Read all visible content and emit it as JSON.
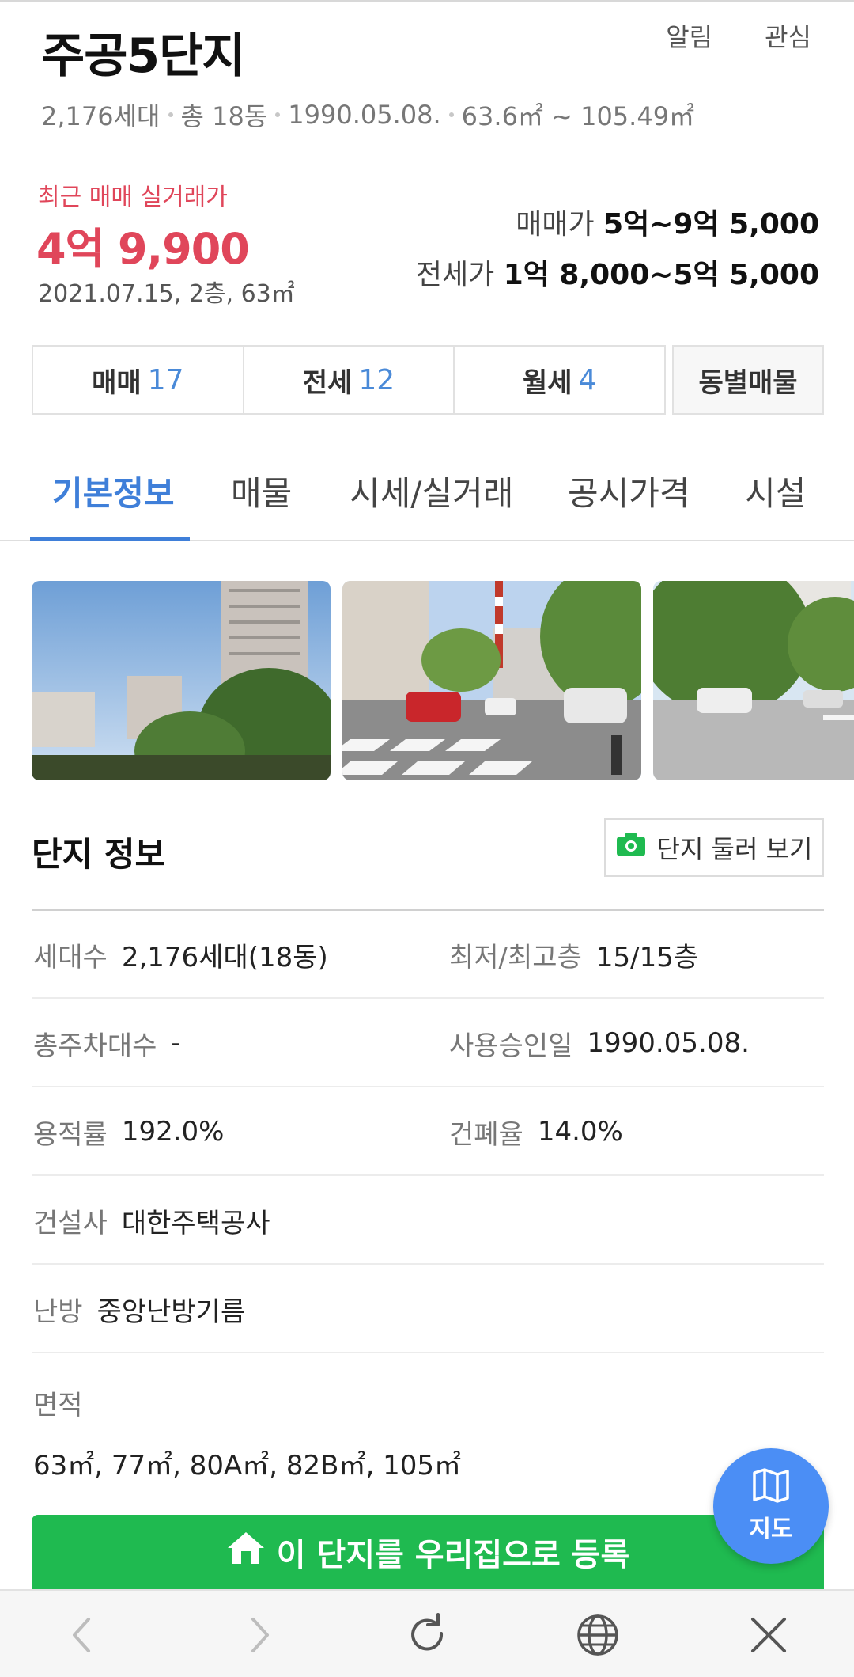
{
  "header": {
    "title": "주공5단지",
    "alarm_label": "알림",
    "favorite_label": "관심",
    "households": "2,176세대",
    "buildings": "총 18동",
    "approval_date": "1990.05.08.",
    "area_range": "63.6㎡ ~ 105.49㎡"
  },
  "price": {
    "recent_label": "최근 매매 실거래가",
    "recent_value": "4억 9,900",
    "recent_meta": "2021.07.15, 2층, 63㎡",
    "sale_label": "매매가",
    "sale_range": "5억~9억 5,000",
    "jeonse_label": "전세가",
    "jeonse_range": "1억 8,000~5억 5,000"
  },
  "deal_tabs": [
    {
      "label": "매매",
      "count": "17"
    },
    {
      "label": "전세",
      "count": "12"
    },
    {
      "label": "월세",
      "count": "4"
    }
  ],
  "dong_button": "동별매물",
  "nav_tabs": [
    "기본정보",
    "매물",
    "시세/실거래",
    "공시가격",
    "시설"
  ],
  "section": {
    "title": "단지 정보",
    "look_button": "단지 둘러 보기"
  },
  "info": {
    "households_k": "세대수",
    "households_v": "2,176세대(18동)",
    "floors_k": "최저/최고층",
    "floors_v": "15/15층",
    "parking_k": "총주차대수",
    "parking_v": "-",
    "approval_k": "사용승인일",
    "approval_v": "1990.05.08.",
    "far_k": "용적률",
    "far_v": "192.0%",
    "bcr_k": "건폐율",
    "bcr_v": "14.0%",
    "builder_k": "건설사",
    "builder_v": "대한주택공사",
    "heating_k": "난방",
    "heating_v": "중앙난방기름",
    "area_k": "면적",
    "area_v": "63㎡, 77㎡, 80A㎡, 82B㎡, 105㎡"
  },
  "register_button": "이 단지를 우리집으로 등록",
  "map_fab_label": "지도",
  "colors": {
    "accent_blue": "#3f7fd9",
    "price_red": "#e0465a",
    "register_green": "#1fba50",
    "fab_blue": "#4b8ef5"
  },
  "icons": [
    "camera-icon",
    "home-icon",
    "map-icon",
    "back-icon",
    "forward-icon",
    "reload-icon",
    "globe-icon",
    "close-icon"
  ]
}
